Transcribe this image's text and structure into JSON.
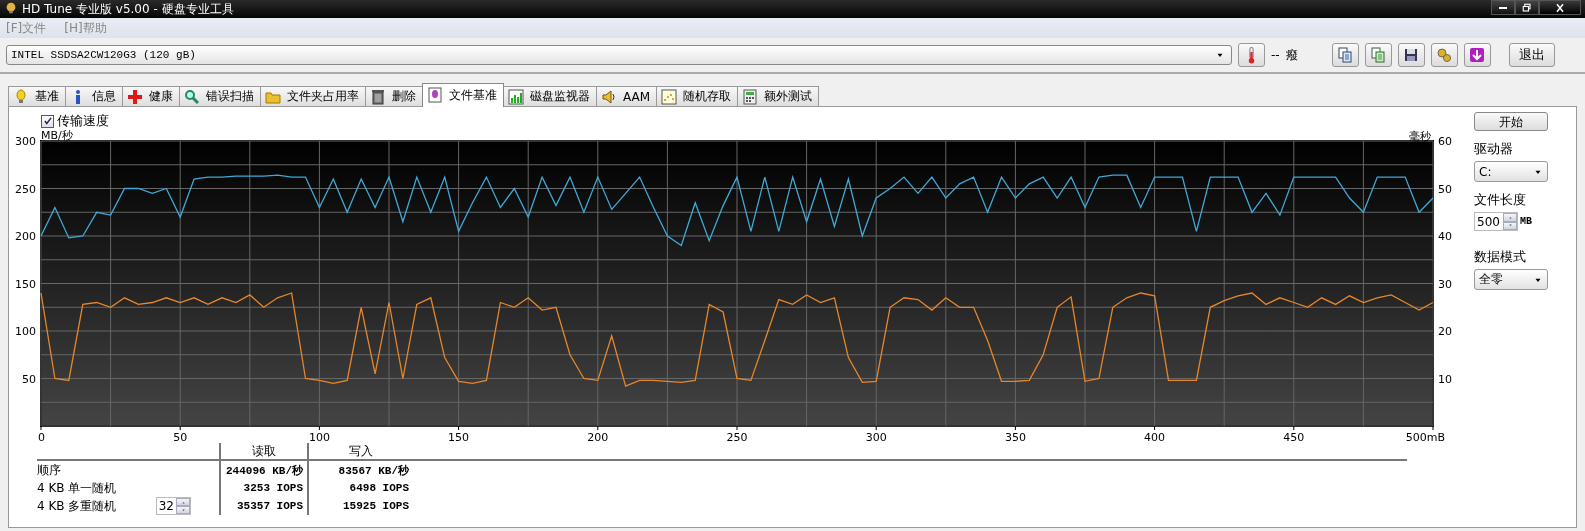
{
  "window": {
    "title": "HD Tune 专业版 v5.00 - 硬盘专业工具"
  },
  "menu": [
    {
      "label": "[F]文件"
    },
    {
      "label": "[H]帮助"
    }
  ],
  "toolbar": {
    "drive": "INTEL SSDSA2CW120G3 (120 gB)",
    "temperature": "--",
    "temperature_unit": "癈",
    "exit_button": "退出"
  },
  "tabs": [
    {
      "label": "基准",
      "selected": false
    },
    {
      "label": "信息",
      "selected": false
    },
    {
      "label": "健康",
      "selected": false
    },
    {
      "label": "错误扫描",
      "selected": false
    },
    {
      "label": "文件夹占用率",
      "selected": false
    },
    {
      "label": "删除",
      "selected": false
    },
    {
      "label": "文件基准",
      "selected": true
    },
    {
      "label": "磁盘监视器",
      "selected": false
    },
    {
      "label": "AAM",
      "selected": false
    },
    {
      "label": "随机存取",
      "selected": false
    },
    {
      "label": "额外测试",
      "selected": false
    }
  ],
  "benchmark": {
    "transfer_speed": {
      "label": "传输速度",
      "checked": true
    },
    "chart_data": {
      "type": "line",
      "grid": true,
      "ylabel": "MB/秒",
      "y2label": "毫秒",
      "xlim": [
        0,
        500
      ],
      "ylim": [
        0,
        300
      ],
      "y2lim": [
        0,
        60
      ],
      "xticks": [
        0,
        50,
        100,
        150,
        200,
        250,
        300,
        350,
        400,
        450,
        {
          "value": 500,
          "label": "500mB"
        }
      ],
      "yticks": [
        50,
        100,
        150,
        200,
        250,
        300
      ],
      "y2ticks": [
        10,
        20,
        30,
        40,
        50,
        60
      ],
      "x": [
        0,
        5,
        10,
        15,
        20,
        25,
        30,
        35,
        40,
        45,
        50,
        55,
        60,
        65,
        70,
        75,
        80,
        85,
        90,
        95,
        100,
        105,
        110,
        115,
        120,
        125,
        130,
        135,
        140,
        145,
        150,
        155,
        160,
        165,
        170,
        175,
        180,
        185,
        190,
        195,
        200,
        205,
        210,
        215,
        220,
        225,
        230,
        235,
        240,
        245,
        250,
        255,
        260,
        265,
        270,
        275,
        280,
        285,
        290,
        295,
        300,
        305,
        310,
        315,
        320,
        325,
        330,
        335,
        340,
        345,
        350,
        355,
        360,
        365,
        370,
        375,
        380,
        385,
        390,
        395,
        400,
        405,
        410,
        415,
        420,
        425,
        430,
        435,
        440,
        445,
        450,
        455,
        460,
        465,
        470,
        475,
        480,
        485,
        490,
        495,
        500
      ],
      "series": [
        {
          "color": "#3fa9d8",
          "values": [
            200,
            230,
            198,
            200,
            225,
            222,
            250,
            250,
            245,
            250,
            220,
            260,
            262,
            262,
            263,
            263,
            263,
            264,
            262,
            262,
            230,
            260,
            225,
            260,
            230,
            262,
            215,
            262,
            225,
            262,
            205,
            235,
            262,
            230,
            250,
            220,
            262,
            232,
            262,
            225,
            262,
            228,
            245,
            262,
            230,
            200,
            190,
            235,
            195,
            232,
            262,
            205,
            262,
            205,
            262,
            215,
            260,
            210,
            260,
            200,
            240,
            250,
            262,
            245,
            262,
            240,
            255,
            262,
            225,
            262,
            240,
            255,
            262,
            240,
            262,
            230,
            262,
            264,
            264,
            230,
            262,
            262,
            262,
            205,
            262,
            262,
            262,
            225,
            245,
            222,
            262,
            262,
            262,
            262,
            240,
            225,
            262,
            262,
            262,
            225,
            240
          ]
        },
        {
          "color": "#e8862a",
          "values": [
            140,
            50,
            48,
            128,
            130,
            125,
            135,
            128,
            130,
            135,
            130,
            135,
            128,
            135,
            130,
            138,
            125,
            135,
            140,
            50,
            48,
            45,
            48,
            125,
            55,
            130,
            50,
            128,
            135,
            72,
            47,
            45,
            48,
            130,
            125,
            135,
            122,
            125,
            75,
            50,
            48,
            95,
            42,
            48,
            48,
            47,
            46,
            48,
            128,
            120,
            50,
            48,
            90,
            133,
            128,
            138,
            130,
            135,
            72,
            46,
            47,
            125,
            135,
            133,
            122,
            135,
            125,
            125,
            90,
            47,
            47,
            48,
            75,
            125,
            136,
            47,
            50,
            125,
            135,
            140,
            137,
            48,
            48,
            48,
            125,
            132,
            137,
            140,
            128,
            135,
            130,
            125,
            135,
            128,
            137,
            130,
            135,
            138,
            130,
            122,
            130
          ]
        }
      ]
    },
    "results": {
      "columns": [
        "读取",
        "写入"
      ],
      "rows": [
        {
          "label": "顺序",
          "read": "244096 KB/秒",
          "write": "83567 KB/秒"
        },
        {
          "label": "4 KB 单一随机",
          "read": "3253 IOPS",
          "write": "6498 IOPS"
        },
        {
          "label": "4 KB 多重随机",
          "queue_depth": "32",
          "read": "35357 IOPS",
          "write": "15925 IOPS"
        }
      ]
    }
  },
  "side_panel": {
    "start_button": "开始",
    "drive_label": "驱动器",
    "drive": "C:",
    "file_length_label": "文件长度",
    "file_length": "500",
    "file_length_unit": "MB",
    "data_mode_label": "数据模式",
    "data_mode": "全零"
  }
}
